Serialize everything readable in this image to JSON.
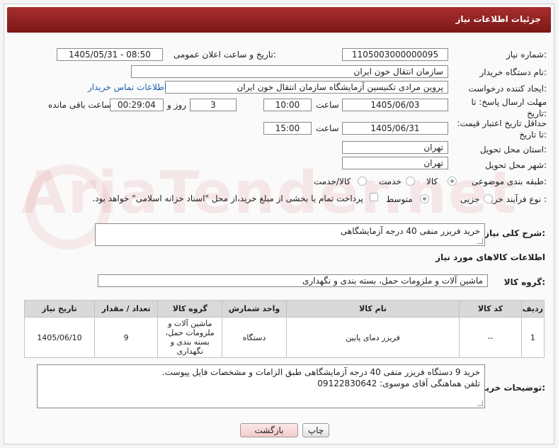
{
  "header": {
    "title": "جزئیات اطلاعات نیاز"
  },
  "fields": {
    "need_number_label": "شماره نیاز:",
    "need_number": "1105003000000095",
    "announce_label": "تاریخ و ساعت اعلان عمومی:",
    "announce_value": "1405/05/31 - 08:50",
    "buyer_org_label": "نام دستگاه خریدار:",
    "buyer_org": "سازمان انتقال خون ایران",
    "requester_label": "ایجاد کننده درخواست:",
    "requester": "پروین مرادی تکنیسین آزمایشگاه سازمان انتقال خون ایران",
    "contact_link": "اطلاعات تماس خریدار",
    "deadline_label": "مهلت ارسال پاسخ: تا تاریخ:",
    "deadline_date": "1405/06/03",
    "time_label": "ساعت",
    "deadline_time": "10:00",
    "days_value": "3",
    "days_label": "روز و",
    "remaining_time": "00:29:04",
    "remaining_label": "ساعت باقی مانده",
    "price_validity_label": "حداقل تاریخ اعتبار قیمت: تا تاریخ:",
    "price_date": "1405/06/31",
    "price_time_label": "ساعت",
    "price_time": "15:00",
    "province_label": "استان محل تحویل:",
    "province": "تهران",
    "city_label": "شهر محل تحویل:",
    "city": "تهران",
    "category_label": "طبقه بندی موضوعی:",
    "category_options": [
      "کالا",
      "خدمت",
      "کالا/خدمت"
    ],
    "process_label": "نوع فرآیند خرید :",
    "process_options": [
      "جزیی",
      "متوسط"
    ],
    "payment_note": "پرداخت تمام یا بخشی از مبلغ خرید،از محل \"اسناد خزانه اسلامی\" خواهد بود."
  },
  "description": {
    "label": "شرح کلی نیاز:",
    "value": "خرید فریزر منفی 40 درجه آزمایشگاهی"
  },
  "goods_info": {
    "title": "اطلاعات کالاهای مورد نیاز",
    "group_label": "گروه کالا:",
    "group_value": "ماشین آلات و ملزومات حمل، بسته بندی و نگهداری"
  },
  "table": {
    "headers": [
      "ردیف",
      "کد کالا",
      "نام کالا",
      "واحد شمارش",
      "گروه کالا",
      "تعداد / مقدار",
      "تاریخ نیاز"
    ],
    "rows": [
      [
        "1",
        "--",
        "فریزر دمای پایین",
        "دستگاه",
        "ماشین آلات و ملزومات حمل، بسته بندی و نگهداری",
        "9",
        "1405/06/10"
      ]
    ]
  },
  "buyer_notes": {
    "label": "توضیحات خریدار:",
    "line1": "خرید 9  دستگاه فریزر منفی 40 درجه آزمایشگاهی  طبق الزامات و مشخصات فایل پیوست.",
    "line2": "تلفن هماهنگی آقای موسوی: 09122830642"
  },
  "buttons": {
    "print": "چاپ",
    "back": "بازگشت"
  },
  "watermark": "AriaTender.net"
}
